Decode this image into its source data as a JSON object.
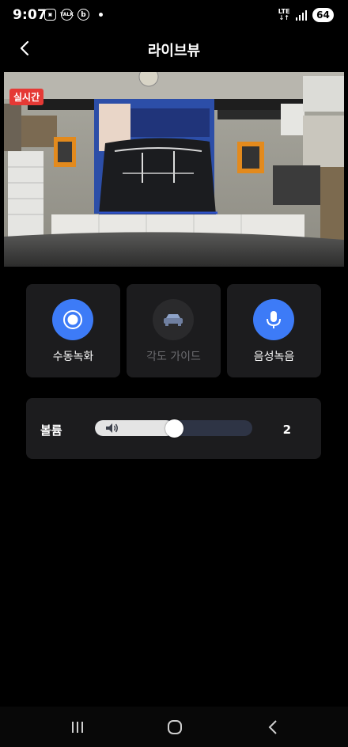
{
  "status_bar": {
    "time": "9:07",
    "network": "LTE",
    "battery": "64",
    "icons": [
      "screenshot-icon",
      "talk-icon",
      "b-app-icon"
    ]
  },
  "header": {
    "back_icon": "chevron-left-icon",
    "title": "라이브뷰"
  },
  "live_view": {
    "badge": "실시간"
  },
  "actions": [
    {
      "label": "수동녹화",
      "icon": "record-icon",
      "color": "#3d7bf7",
      "enabled": true
    },
    {
      "label": "각도 가이드",
      "icon": "car-icon",
      "color": "#2a2a2c",
      "enabled": false
    },
    {
      "label": "음성녹음",
      "icon": "microphone-icon",
      "color": "#3d7bf7",
      "enabled": true
    }
  ],
  "volume": {
    "label": "볼륨",
    "value": "2",
    "icon": "speaker-icon",
    "level_fraction": 0.5
  },
  "nav": {
    "icons": [
      "recents-icon",
      "home-icon",
      "back-icon"
    ]
  },
  "colors": {
    "accent": "#3d7bf7",
    "live_badge": "#e53935",
    "card_bg": "#1c1c1e"
  }
}
